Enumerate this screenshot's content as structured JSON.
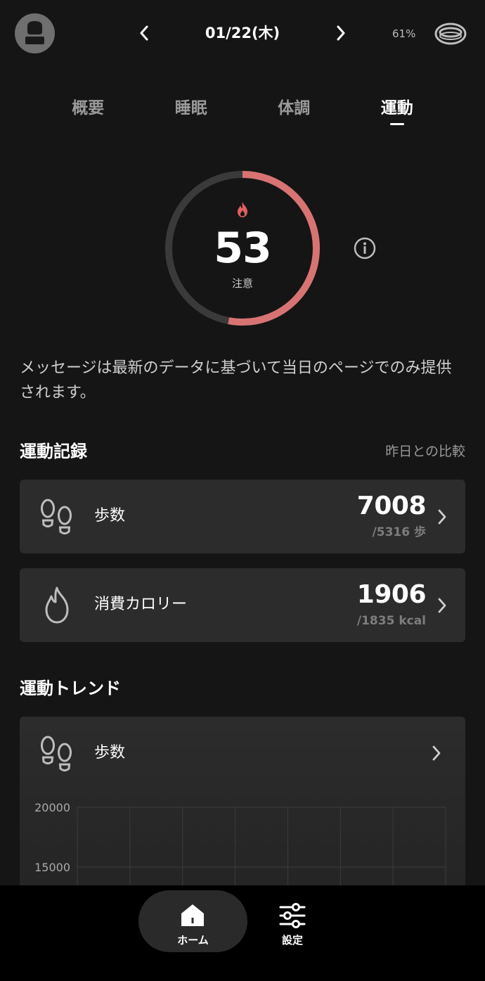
{
  "header": {
    "date": "01/22(木)",
    "battery": "61%",
    "icons": {
      "avatar": "user-avatar-icon",
      "prev": "chevron-left-icon",
      "next": "chevron-right-icon",
      "device": "smart-ring-icon"
    }
  },
  "tabs": [
    {
      "label": "概要",
      "active": false
    },
    {
      "label": "睡眠",
      "active": false
    },
    {
      "label": "体調",
      "active": false
    },
    {
      "label": "運動",
      "active": true
    }
  ],
  "score": {
    "value": "53",
    "status": "注意",
    "progress": 0.53,
    "accent_color": "#d87373",
    "track_color": "#3a3a3a",
    "icon": "flame-icon"
  },
  "message": "メッセージは最新のデータに基づいて当日のページでのみ提供されます。",
  "records": {
    "title": "運動記録",
    "compare_note": "昨日との比較",
    "items": [
      {
        "icon": "footprints-icon",
        "label": "歩数",
        "value": "7008",
        "previous": "/5316 歩"
      },
      {
        "icon": "flame-icon",
        "label": "消費カロリー",
        "value": "1906",
        "previous": "/1835 kcal"
      }
    ]
  },
  "trend": {
    "title": "運動トレンド",
    "card_label": "歩数",
    "icon": "footprints-icon",
    "chart_data": {
      "type": "bar",
      "ytick_labels": [
        "20000",
        "15000"
      ],
      "yticks": [
        20000,
        15000
      ],
      "columns": 7,
      "grid": true
    }
  },
  "bottom_nav": {
    "items": [
      {
        "label": "ホーム",
        "icon": "home-icon",
        "active": true
      },
      {
        "label": "設定",
        "icon": "sliders-icon",
        "active": false
      }
    ]
  }
}
